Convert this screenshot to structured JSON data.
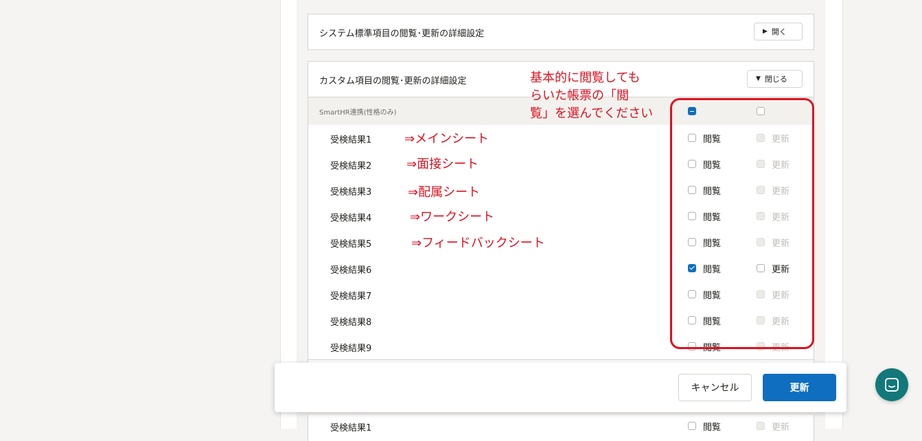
{
  "system_section": {
    "title": "システム標準項目の閲覧･更新の詳細設定",
    "button_label": "開く"
  },
  "custom_section": {
    "title": "カスタム項目の閲覧･更新の詳細設定",
    "button_label": "閉じる",
    "group_label": "SmartHR連携(性格のみ)",
    "rows": [
      {
        "label": "受検結果1",
        "view_label": "閲覧",
        "update_label": "更新",
        "view_checked": false,
        "update_enabled": false
      },
      {
        "label": "受検結果2",
        "view_label": "閲覧",
        "update_label": "更新",
        "view_checked": false,
        "update_enabled": false
      },
      {
        "label": "受検結果3",
        "view_label": "閲覧",
        "update_label": "更新",
        "view_checked": false,
        "update_enabled": false
      },
      {
        "label": "受検結果4",
        "view_label": "閲覧",
        "update_label": "更新",
        "view_checked": false,
        "update_enabled": false
      },
      {
        "label": "受検結果5",
        "view_label": "閲覧",
        "update_label": "更新",
        "view_checked": false,
        "update_enabled": false
      },
      {
        "label": "受検結果6",
        "view_label": "閲覧",
        "update_label": "更新",
        "view_checked": true,
        "update_enabled": true
      },
      {
        "label": "受検結果7",
        "view_label": "閲覧",
        "update_label": "更新",
        "view_checked": false,
        "update_enabled": false
      },
      {
        "label": "受検結果8",
        "view_label": "閲覧",
        "update_label": "更新",
        "view_checked": false,
        "update_enabled": false
      },
      {
        "label": "受検結果9",
        "view_label": "閲覧",
        "update_label": "更新",
        "view_checked": false,
        "update_enabled": false
      }
    ],
    "bottom_row": {
      "label": "受検結果1",
      "view_label": "閲覧",
      "update_label": "更新"
    }
  },
  "annotations": {
    "instruction_line1": "基本的に閲覧しても",
    "instruction_line2": "らいた帳票の「閲",
    "instruction_line3": "覧」を選んでください",
    "notes": [
      "⇒メインシート",
      "⇒面接シート",
      "⇒配属シート",
      "⇒ワークシート",
      "⇒フィードバックシート"
    ],
    "color": "#e0101f"
  },
  "actions": {
    "cancel_label": "キャンセル",
    "submit_label": "更新",
    "primary_color": "#0f6ebf"
  },
  "chat": {
    "icon": "chat-icon",
    "color": "#12787a"
  }
}
